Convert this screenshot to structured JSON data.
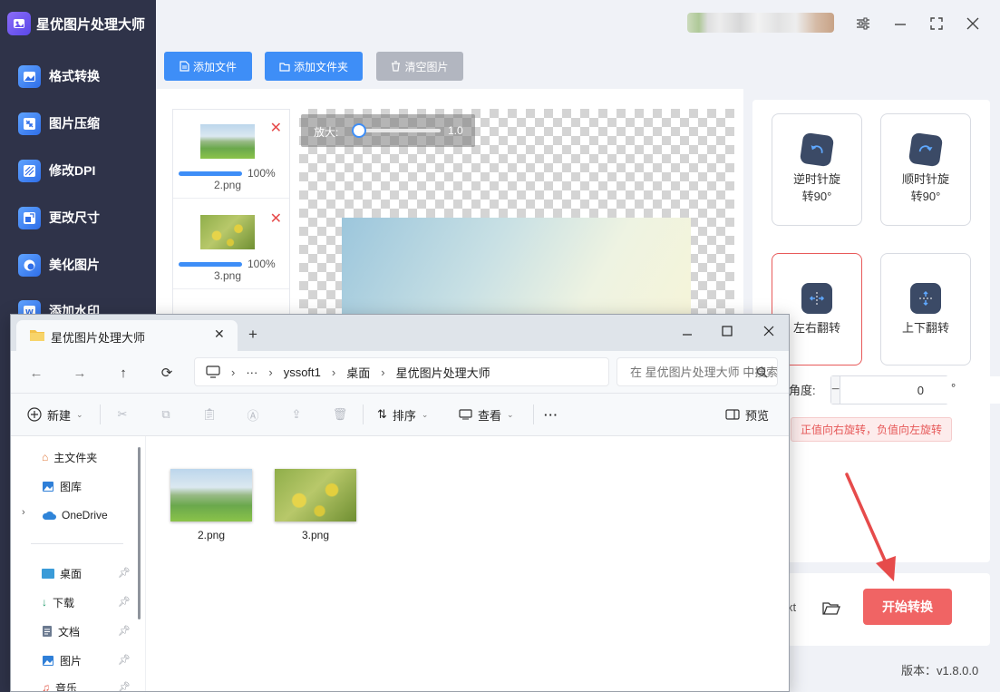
{
  "app": {
    "title": "星优图片处理大师",
    "version": "版本：v1.8.0.0"
  },
  "sidebar": {
    "items": [
      {
        "label": "格式转换",
        "icon": "image-convert-icon"
      },
      {
        "label": "图片压缩",
        "icon": "image-compress-icon"
      },
      {
        "label": "修改DPI",
        "icon": "dpi-icon"
      },
      {
        "label": "更改尺寸",
        "icon": "resize-icon"
      },
      {
        "label": "美化图片",
        "icon": "beautify-icon"
      },
      {
        "label": "添加水印",
        "icon": "watermark-icon"
      }
    ]
  },
  "toolbar": {
    "add_file": "添加文件",
    "add_folder": "添加文件夹",
    "clear_images": "清空图片"
  },
  "file_list": [
    {
      "name": "2.png",
      "progress": "100%"
    },
    {
      "name": "3.png",
      "progress": "100%"
    }
  ],
  "zoom": {
    "label": "放大:",
    "value": "1.0"
  },
  "tools": {
    "rotate_ccw": "逆时针旋\n转90°",
    "rotate_cw": "顺时针旋\n转90°",
    "flip_h": "左右翻转",
    "flip_v": "上下翻转"
  },
  "angle": {
    "label": "角度:",
    "value": "0",
    "minus": "−",
    "plus": "+",
    "unit": "°",
    "hint": "正值向右旋转，负值向左旋转"
  },
  "output": {
    "partial_text": "xt",
    "start_button": "开始转换"
  },
  "explorer": {
    "tab_title": "星优图片处理大师",
    "new_tab": "+",
    "breadcrumb": [
      "yssoft1",
      "桌面",
      "星优图片处理大师"
    ],
    "more": "···",
    "search_placeholder": "在 星优图片处理大师 中搜索",
    "toolbar": {
      "new": "新建",
      "sort": "排序",
      "view": "查看",
      "more": "···",
      "preview": "预览"
    },
    "nav": [
      {
        "label": "主文件夹",
        "icon": "home-icon"
      },
      {
        "label": "图库",
        "icon": "gallery-icon"
      },
      {
        "label": "OneDrive",
        "icon": "cloud-icon"
      },
      {
        "label": "桌面",
        "icon": "desktop-icon"
      },
      {
        "label": "下载",
        "icon": "download-icon"
      },
      {
        "label": "文档",
        "icon": "document-icon"
      },
      {
        "label": "图片",
        "icon": "pictures-icon"
      },
      {
        "label": "音乐",
        "icon": "music-icon"
      }
    ],
    "files": [
      {
        "name": "2.png"
      },
      {
        "name": "3.png"
      }
    ]
  },
  "colors": {
    "sidebar_bg": "#2f3349",
    "primary": "#3e8ef7",
    "start": "#f06464",
    "danger": "#e64b4b"
  }
}
